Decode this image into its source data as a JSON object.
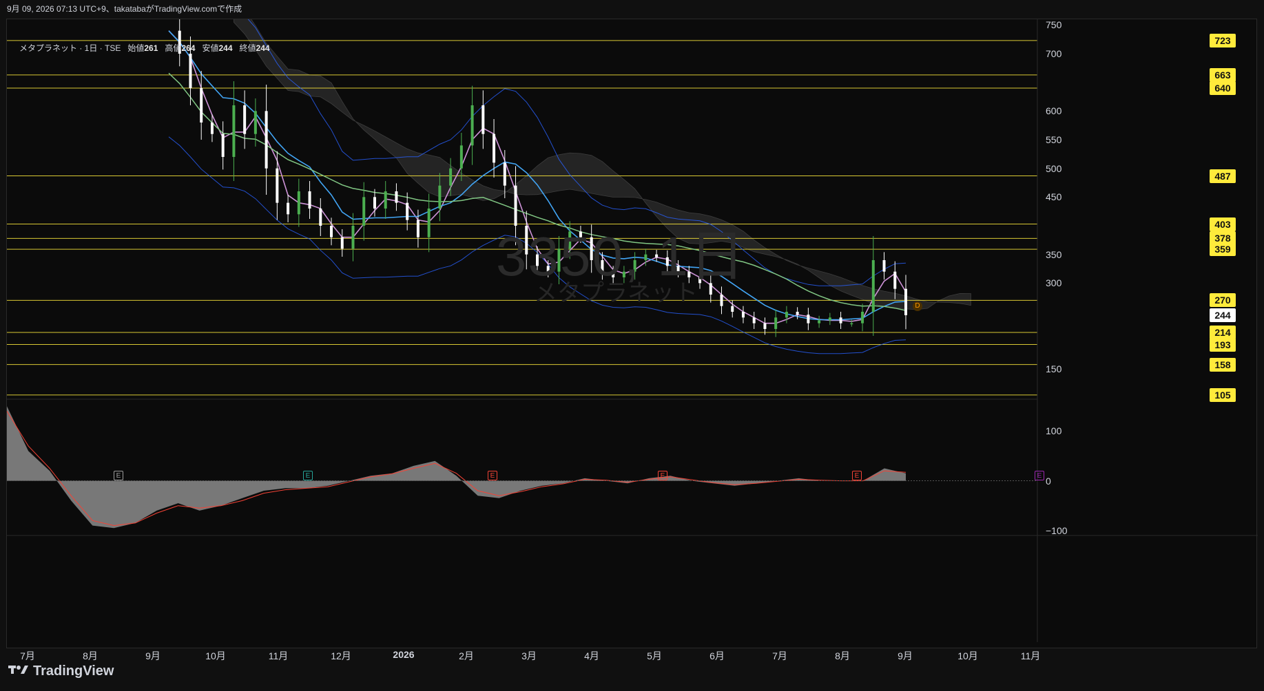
{
  "header": {
    "caption": "9月 09, 2026 07:13 UTC+9、takatabaがTradingView.comで作成"
  },
  "legend": {
    "symbol_info": "メタプラネット · 1日 · TSE",
    "open_label": "始値",
    "open": "261",
    "high_label": "高値",
    "high": "264",
    "low_label": "安値",
    "low": "244",
    "close_label": "終値",
    "close": "244"
  },
  "watermark": {
    "symbol": "3350, 1日",
    "name": "メタプラネット"
  },
  "footer": {
    "brand": "TradingView",
    "logo_icon": "tv-logo-icon"
  },
  "colors": {
    "level_line": "#ffeb3b",
    "up": "#4caf50",
    "down": "#ffffff",
    "bb": "#2962ff",
    "ma_fast": "#ce93d8",
    "ma_mid": "#42a5f5",
    "ma_slow": "#81c784",
    "cloud": "#3a3a3a",
    "macd_hist": "#9e9e9e",
    "macd_signal": "#f44336"
  },
  "chart_data": [
    {
      "type": "candlestick",
      "title": "",
      "y_axis_ticks": [
        750,
        700,
        600,
        550,
        500,
        450,
        350,
        300,
        150
      ],
      "ylim": [
        100,
        760
      ],
      "x_labels": [
        "7月",
        "8月",
        "9月",
        "10月",
        "11月",
        "12月",
        "2026",
        "2月",
        "3月",
        "4月",
        "5月",
        "6月",
        "7月",
        "8月",
        "9月",
        "10月",
        "11月"
      ],
      "horizontal_levels": [
        723,
        663,
        640,
        487,
        403,
        378,
        359,
        270,
        214,
        193,
        158,
        105
      ],
      "last_price": 244,
      "earnings_markers": [
        "E",
        "E",
        "E",
        "E",
        "E",
        "E"
      ],
      "dividend_marker": "D",
      "series": [
        {
          "name": "",
          "type": "close_path",
          "values": [
            740,
            700,
            640,
            580,
            560,
            520,
            610,
            560,
            600,
            500,
            440,
            420,
            460,
            430,
            400,
            380,
            360,
            400,
            450,
            430,
            460,
            440,
            410,
            380,
            430,
            470,
            500,
            540,
            610,
            560,
            510,
            470,
            400,
            350,
            330,
            320,
            360,
            390,
            380,
            340,
            320,
            310,
            320,
            340,
            350,
            345,
            330,
            320,
            310,
            300,
            280,
            260,
            250,
            240,
            230,
            220,
            240,
            250,
            245,
            230,
            235,
            240,
            230,
            230,
            250,
            340,
            320,
            290,
            244
          ]
        }
      ]
    },
    {
      "type": "area",
      "title": "",
      "y_axis_ticks": [
        100,
        0,
        -100
      ],
      "ylim": [
        -110,
        160
      ],
      "series": [
        {
          "name": "",
          "type": "histogram",
          "values": [
            150,
            60,
            20,
            -40,
            -90,
            -95,
            -85,
            -60,
            -45,
            -60,
            -50,
            -35,
            -20,
            -15,
            -15,
            -10,
            0,
            10,
            15,
            30,
            40,
            10,
            -30,
            -35,
            -20,
            -10,
            -5,
            5,
            0,
            -5,
            5,
            10,
            0,
            -5,
            -10,
            -5,
            0,
            5,
            0,
            0,
            0,
            25,
            15
          ]
        },
        {
          "name": "",
          "type": "signal",
          "values": [
            140,
            70,
            25,
            -30,
            -80,
            -90,
            -85,
            -65,
            -50,
            -55,
            -50,
            -40,
            -25,
            -18,
            -15,
            -12,
            -2,
            8,
            14,
            25,
            35,
            15,
            -20,
            -30,
            -22,
            -12,
            -6,
            3,
            1,
            -3,
            3,
            8,
            2,
            -4,
            -8,
            -5,
            -1,
            3,
            1,
            0,
            0,
            20,
            17
          ]
        }
      ]
    }
  ]
}
